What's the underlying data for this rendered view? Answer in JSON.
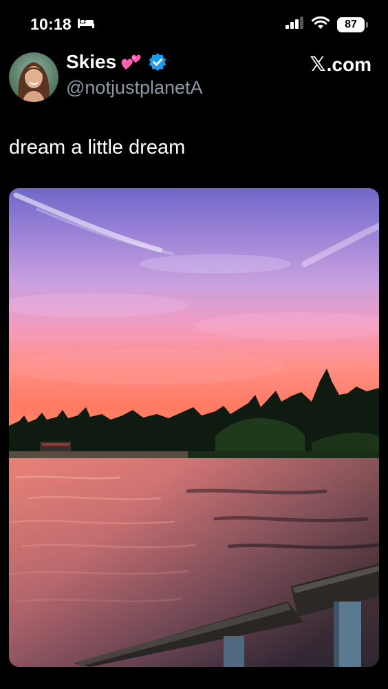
{
  "status_bar": {
    "time": "10:18",
    "battery": "87"
  },
  "author": {
    "display_name": "Skies",
    "handle": "@notjustplanetA",
    "verified": true
  },
  "brand": {
    "logo_letter": "𝕏",
    "domain_suffix": ".com"
  },
  "tweet": {
    "text": "dream a little dream"
  },
  "media": {
    "icon": "sunset-lake-photo"
  },
  "colors": {
    "background": "#000000",
    "handle": "#8b98a5",
    "verified": "#1d9bf0"
  }
}
